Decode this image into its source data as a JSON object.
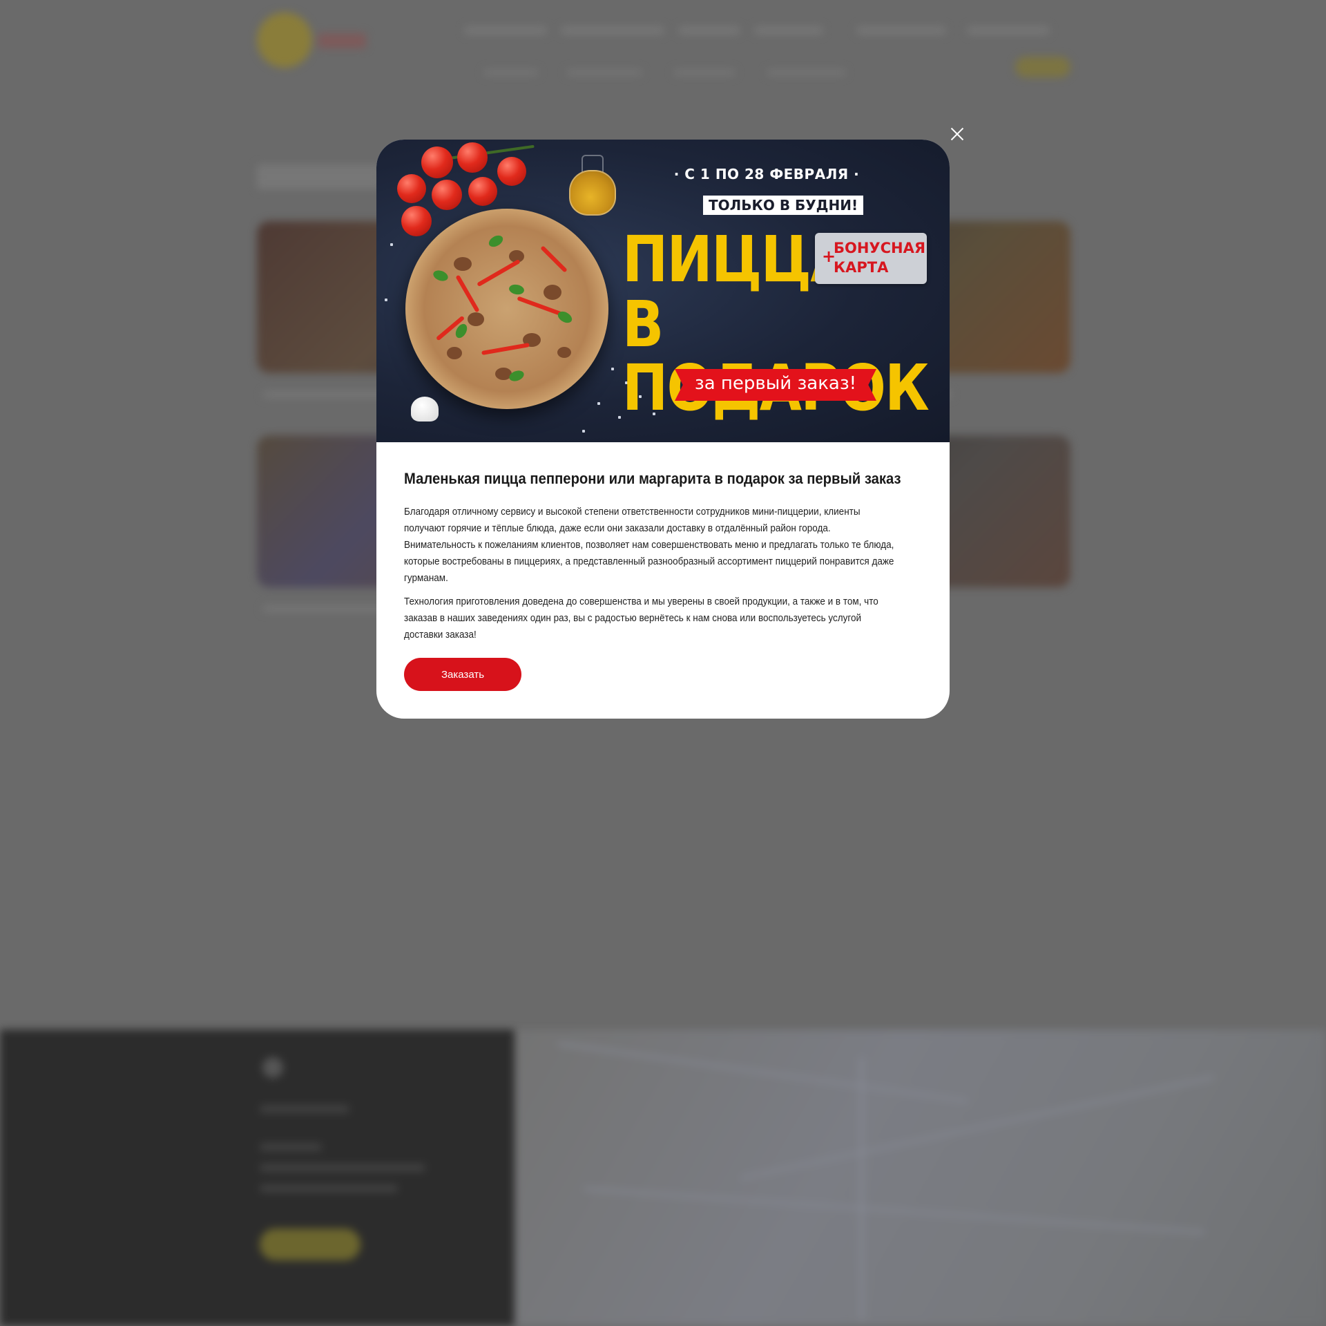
{
  "modal": {
    "close_label": "×",
    "banner": {
      "date_line": "· С 1 ПО 28 ФЕВРАЛЯ ·",
      "weekdays_only": "ТОЛЬКО В БУДНИ!",
      "headline_line1": "ПИЦЦА",
      "headline_line2": "В ПОДАРОК",
      "bonus_plus": "+",
      "bonus_line1": "БОНУСНАЯ",
      "bonus_line2": "КАРТА",
      "ribbon": "за первый заказ!"
    },
    "title": "Маленькая пицца пепперони или маргарита в подарок за первый заказ",
    "paragraph1": "Благодаря отличному сервису и высокой степени ответственности сотрудников мини-пиццерии, клиенты получают горячие и тёплые блюда, даже если они заказали доставку в отдалённый район города. Внимательность к пожеланиям клиентов, позволяет нам совершенствовать меню и предлагать только те блюда, которые востребованы в пиццериях, а представленный разнообразный ассортимент пиццерий понравится даже гурманам.",
    "paragraph2": "Технология приготовления доведена до совершенства и мы уверены в своей продукции, а также и в том, что заказав в наших заведениях один раз, вы с радостью вернётесь к нам снова или воспользуетесь услугой доставки заказа!",
    "order_button": "Заказать"
  },
  "colors": {
    "overlay": "#6a6a6a",
    "accent_red": "#d7121b",
    "banner_yellow": "#f5c400",
    "banner_navy": "#1c2438"
  },
  "icons": {
    "close": "close-icon"
  }
}
